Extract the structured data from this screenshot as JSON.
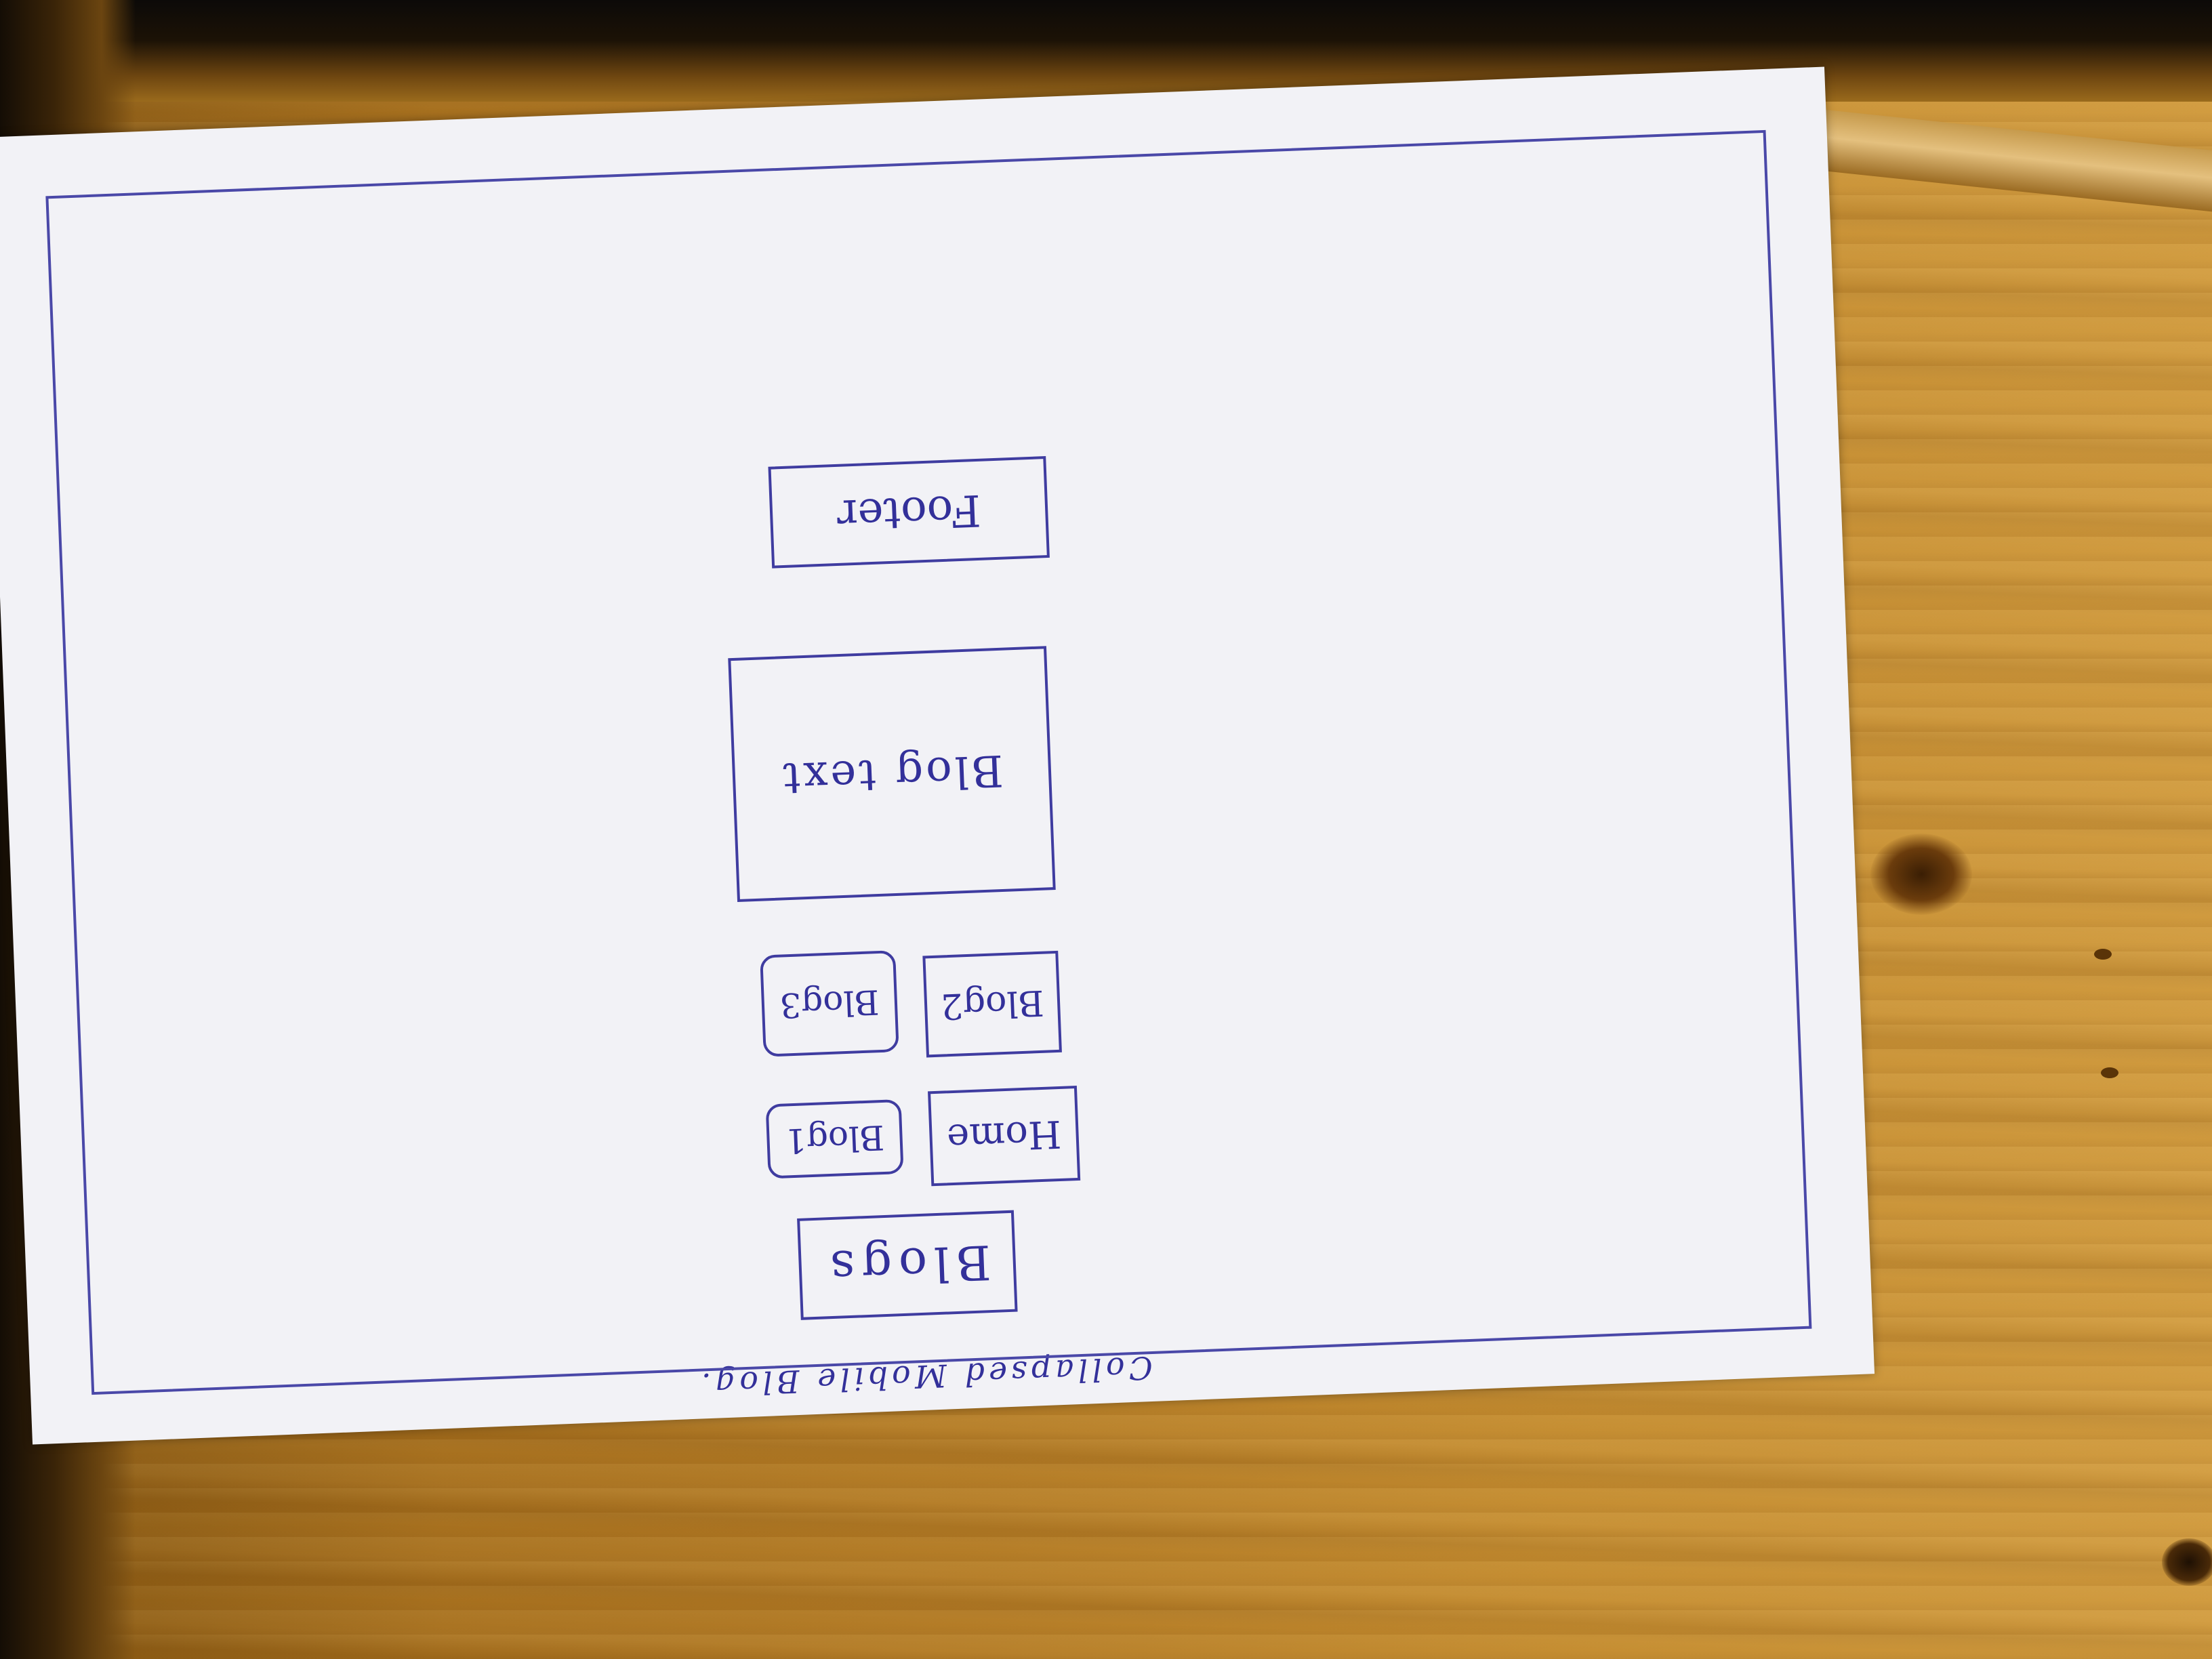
{
  "sketch": {
    "caption": "Collapsed Mobile Blog.",
    "title": "Blogs",
    "nav": {
      "home": "Home",
      "blog1": "Blog1",
      "blog2": "Blog2",
      "blog3": "Blog3"
    },
    "content": "Blog text",
    "footer": "Footer"
  }
}
